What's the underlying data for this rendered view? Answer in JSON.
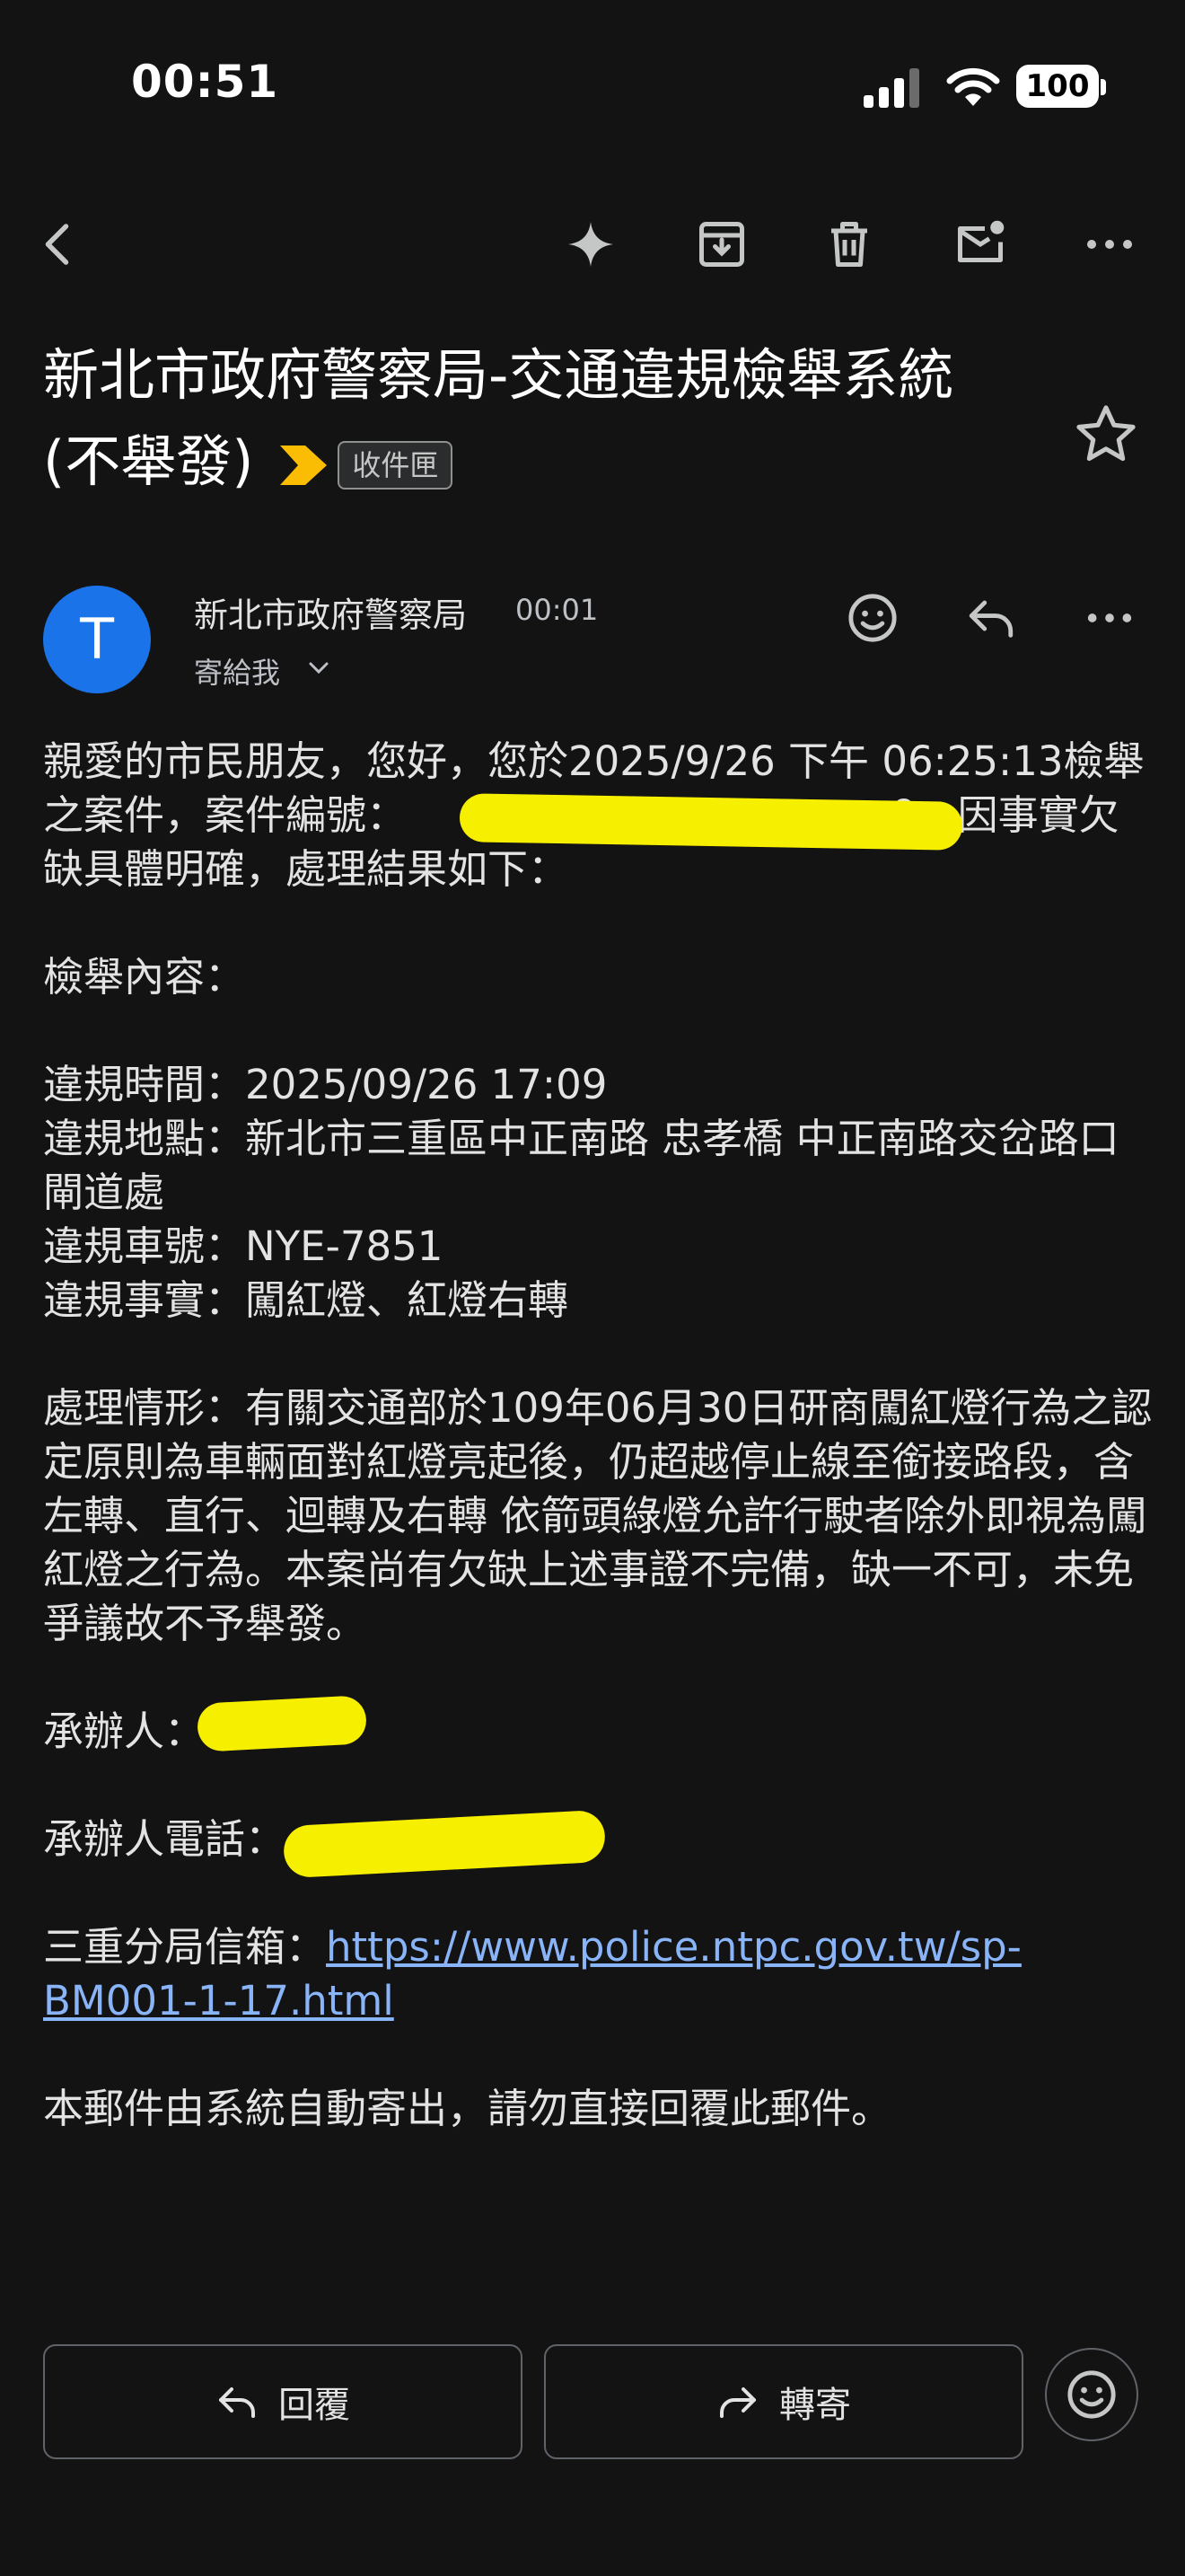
{
  "status_bar": {
    "time": "00:51",
    "battery": "100"
  },
  "toolbar": {
    "icons": [
      "back-icon",
      "sparkle-icon",
      "archive-icon",
      "trash-icon",
      "mark-unread-icon",
      "more-icon"
    ]
  },
  "subject": {
    "line1": "新北市政府警察局-交通違規檢舉系統",
    "line2": "(不舉發)",
    "label": "收件匣"
  },
  "sender": {
    "avatar_letter": "T",
    "name": "新北市政府警察局",
    "time": "00:01",
    "to": "寄給我",
    "avatar_color": "#1a73e8"
  },
  "body": {
    "intro": "親愛的市民朋友，您好，您於2025/9/26 下午 06:25:13檢舉之案件，案件編號：",
    "intro_tail": "9，因事實欠缺具體明確，處理結果如下：",
    "section_title": "檢舉內容：",
    "time_label": "違規時間：2025/09/26 17:09",
    "location": "違規地點：新北市三重區中正南路 忠孝橋 中正南路交岔路口閘道處",
    "plate": "違規車號：NYE-7851",
    "fact": "違規事實：闖紅燈、紅燈右轉",
    "handling": "處理情形：有關交通部於109年06月30日研商闖紅燈行為之認定原則為車輛面對紅燈亮起後，仍超越停止線至銜接路段，含左轉、直行、迴轉及右轉 依箭頭綠燈允許行駛者除外即視為闖紅燈之行為。本案尚有欠缺上述事證不完備，缺一不可，未免爭議故不予舉發。",
    "handler_label": "承辦人：",
    "phone_label": "承辦人電話：",
    "mailbox_label": "三重分局信箱：",
    "mailbox_link": "https://www.police.ntpc.gov.tw/sp-BM001-1-17.html",
    "footer": "本郵件由系統自動寄出，請勿直接回覆此郵件。"
  },
  "actions": {
    "reply": "回覆",
    "forward": "轉寄"
  },
  "colors": {
    "background": "#131314",
    "redaction": "#f7ef00",
    "link": "#8ab4f8",
    "label_chevron": "#fbbc04"
  }
}
